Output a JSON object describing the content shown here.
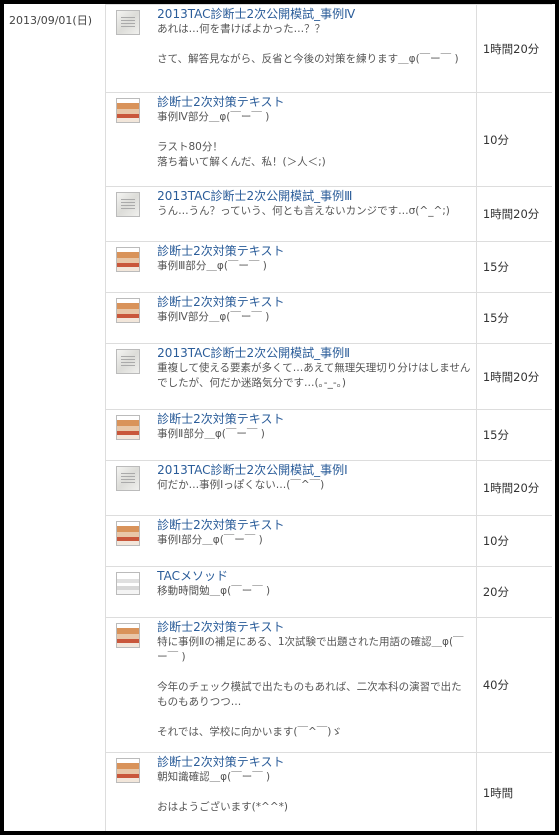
{
  "date": "2013/09/01(日)",
  "rows": [
    {
      "thumb": "exam-sheet-photo",
      "title": "2013TAC診断士2次公開模試_事例Ⅳ",
      "desc": "あれは…何を書けばよかった…？？\n\nさて、解答見ながら、反省と今後の対策を練ります＿φ(￣ー￣ )",
      "time": "1時間20分"
    },
    {
      "thumb": "textbook-photo",
      "title": "診断士2次対策テキスト",
      "desc": "事例Ⅳ部分＿φ(￣ー￣ )\n\nラスト80分！\n落ち着いて解くんだ、私！(＞人＜;)",
      "time": "10分"
    },
    {
      "thumb": "exam-sheet-photo",
      "title": "2013TAC診断士2次公開模試_事例Ⅲ",
      "desc": "うん…うん？っていう、何とも言えないカンジです…σ(^_^;)",
      "time": "1時間20分"
    },
    {
      "thumb": "textbook-photo",
      "title": "診断士2次対策テキスト",
      "desc": "事例Ⅲ部分＿φ(￣ー￣ )",
      "time": "15分"
    },
    {
      "thumb": "textbook-photo",
      "title": "診断士2次対策テキスト",
      "desc": "事例Ⅳ部分＿φ(￣ー￣ )",
      "time": "15分"
    },
    {
      "thumb": "exam-sheet-photo",
      "title": "2013TAC診断士2次公開模試_事例Ⅱ",
      "desc": "重複して使える要素が多くて…あえて無理矢理切り分けはしませんでしたが、何だか迷路気分です…(｡-_-｡)",
      "time": "1時間20分"
    },
    {
      "thumb": "textbook-photo",
      "title": "診断士2次対策テキスト",
      "desc": "事例Ⅱ部分＿φ(￣ー￣ )",
      "time": "15分"
    },
    {
      "thumb": "exam-sheet-photo",
      "title": "2013TAC診断士2次公開模試_事例Ⅰ",
      "desc": "何だか…事例Ⅰっぽくない…(￣^￣)",
      "time": "1時間20分"
    },
    {
      "thumb": "textbook-photo",
      "title": "診断士2次対策テキスト",
      "desc": "事例Ⅰ部分＿φ(￣ー￣ )",
      "time": "10分"
    },
    {
      "thumb": "method-book-photo",
      "title": "TACメソッド",
      "desc": "移動時間勉＿φ(￣ー￣ )",
      "time": "20分"
    },
    {
      "thumb": "textbook-photo",
      "title": "診断士2次対策テキスト",
      "desc": "特に事例Ⅱの補足にある、1次試験で出題された用語の確認＿φ(￣ー￣ )\n\n今年のチェック模試で出たものもあれば、二次本科の演習で出たものもありつつ…\n\nそれでは、学校に向かいます(￣^￣)ゞ",
      "time": "40分"
    },
    {
      "thumb": "textbook-photo",
      "title": "診断士2次対策テキスト",
      "desc": "朝知識確認＿φ(￣ー￣ )\n\nおはようございます(*^^*)",
      "time": "1時間"
    }
  ]
}
